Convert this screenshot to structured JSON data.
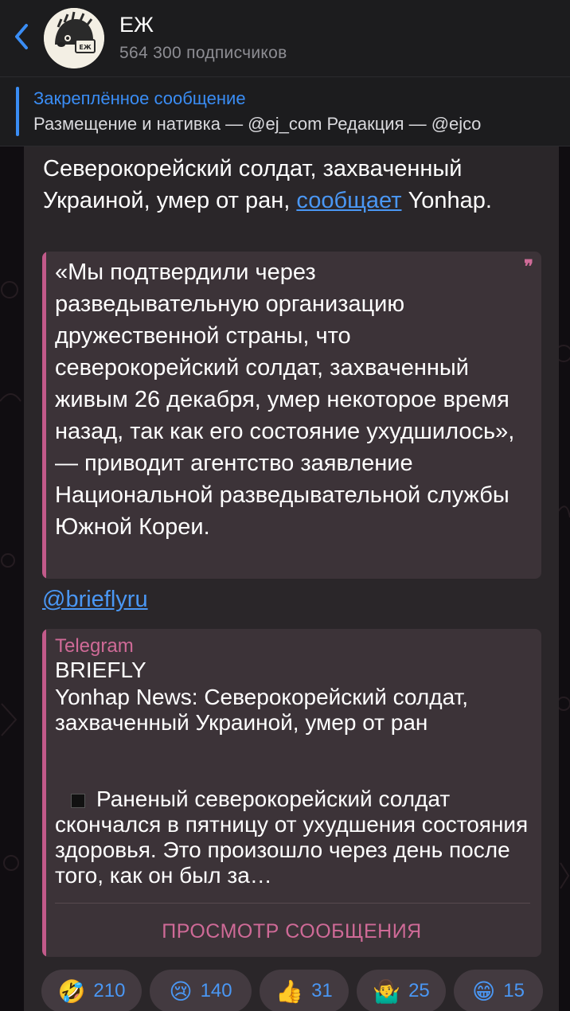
{
  "header": {
    "title": "ЕЖ",
    "subtitle": "564 300 подписчиков",
    "avatar_label": "ЕЖ"
  },
  "pinned": {
    "title": "Закреплённое сообщение",
    "text": "Размещение и нативка — @ej_com Редакция — @ejco"
  },
  "message": {
    "text_before_link": "Северокорейский солдат, захваченный Украиной, умер от ран, ",
    "link_text": "сообщает",
    "text_after_link": " Yonhap.",
    "quote_mark": "❞",
    "quote": "«Мы подтвердили через разведывательную организацию дружественной страны, что северокорейский солдат, захваченный живым 26 декабря, умер некоторое время назад, так как его состояние ухудшилось», — приводит агентство заявление Национальной разведывательной службы Южной Кореи.",
    "handle": "@brieflyru"
  },
  "preview": {
    "site": "Telegram",
    "title": "BRIEFLY",
    "description": "Yonhap News: Северокорейский солдат, захваченный Украиной, умер от ран",
    "body": "Раненый северокорейский солдат скончался в пятницу от ухудшения состояния здоровья. Это произошло через день после того, как он был за…",
    "button": "ПРОСМОТР СООБЩЕНИЯ"
  },
  "reactions": [
    {
      "emoji": "🤣",
      "count": "210"
    },
    {
      "emoji": "😢",
      "count": "140"
    },
    {
      "emoji": "👍",
      "count": "31"
    },
    {
      "emoji": "🤷‍♂️",
      "count": "25"
    },
    {
      "emoji": "😁",
      "count": "15"
    }
  ],
  "colors": {
    "accent": "#3a8df5",
    "link": "#4a97f4",
    "quote_accent": "#c25a8a",
    "bubble": "#2a2629"
  }
}
